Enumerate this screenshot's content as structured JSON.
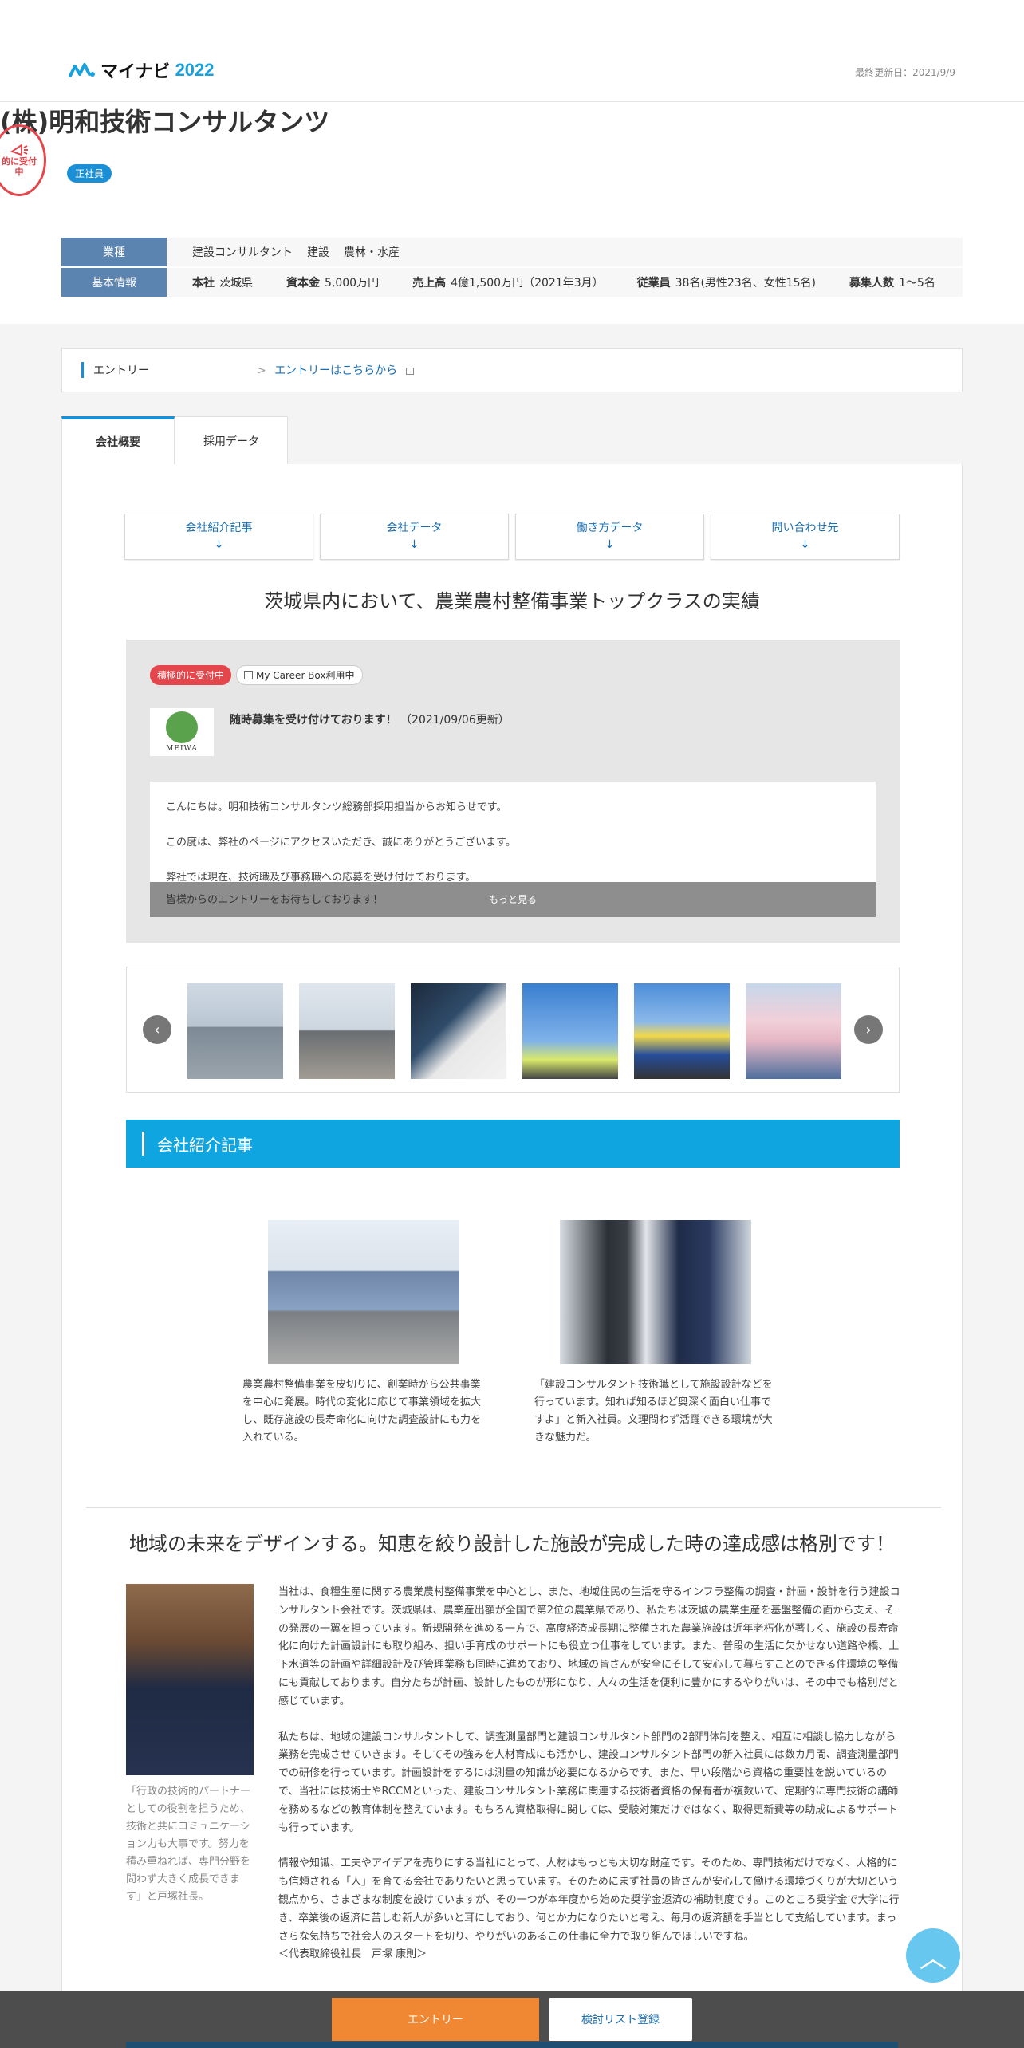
{
  "header": {
    "logo_text": "マイナビ",
    "logo_year": "2022",
    "updated": "最終更新日：2021/9/9"
  },
  "company": {
    "stamp": [
      "的に受付",
      "中"
    ],
    "name": "(株)明和技術コンサルタンツ",
    "badge": "正社員"
  },
  "info": {
    "industry_label": "業種",
    "industry_items": [
      "建設コンサルタント",
      "建設",
      "農林・水産"
    ],
    "basic_label": "基本情報",
    "basic": [
      {
        "k": "本社",
        "v": "茨城県"
      },
      {
        "k": "資本金",
        "v": "5,000万円"
      },
      {
        "k": "売上高",
        "v": "4億1,500万円（2021年3月）"
      },
      {
        "k": "従業員",
        "v": "38名(男性23名、女性15名)"
      },
      {
        "k": "募集人数",
        "v": "1～5名"
      }
    ]
  },
  "entry": {
    "label": "エントリー",
    "link": "エントリーはこちらから"
  },
  "tabs": [
    "会社概要",
    "採用データ"
  ],
  "subnav": [
    "会社紹介記事",
    "会社データ",
    "働き方データ",
    "問い合わせ先"
  ],
  "subnav_arrow": "↓",
  "headline": "茨城県内において、農業農村整備事業トップクラスの実績",
  "news": {
    "tag_active": "積極的に受付中",
    "tag_box": "My Career Box利用中",
    "logo_name": "MEIWA",
    "title": "随時募集を受け付けております！",
    "date": "（2021/09/06更新）",
    "lines": [
      "こんにちは。明和技術コンサルタンツ総務部採用担当からお知らせです。",
      "この度は、弊社のページにアクセスいただき、誠にありがとうございます。",
      "弊社では現在、技術職及び事務職への応募を受け付けております。"
    ],
    "last_line": "皆様からのエントリーをお待ちしております！",
    "more": "もっと見る"
  },
  "carousel": {
    "prev": "‹",
    "next": "›"
  },
  "section_title": "会社紹介記事",
  "features": [
    {
      "text": "農業農村整備事業を皮切りに、創業時から公共事業を中心に発展。時代の変化に応じて事業領域を拡大し、既存施設の長寿命化に向けた調査設計にも力を入れている。"
    },
    {
      "text": "「建設コンサルタント技術職として施設設計などを行っています。知れば知るほど奥深く面白い仕事ですよ」と新入社員。文理問わず活躍できる環境が大きな魅力だ。"
    }
  ],
  "message": {
    "title": "地域の未来をデザインする。知恵を絞り設計した施設が完成した時の達成感は格別です！",
    "caption": "「行政の技術的パートナーとしての役割を担うため、技術と共にコミュニケーション力も大事です。努力を積み重ねれば、専門分野を問わず大きく成長できます」と戸塚社長。",
    "paragraphs": [
      "当社は、食糧生産に関する農業農村整備事業を中心とし、また、地域住民の生活を守るインフラ整備の調査・計画・設計を行う建設コンサルタント会社です。茨城県は、農業産出額が全国で第2位の農業県であり、私たちは茨城の農業生産を基盤整備の面から支え、その発展の一翼を担っています。新規開発を進める一方で、高度経済成長期に整備された農業施設は近年老朽化が著しく、施設の長寿命化に向けた計画設計にも取り組み、担い手育成のサポートにも役立つ仕事をしています。また、普段の生活に欠かせない道路や橋、上下水道等の計画や詳細設計及び管理業務も同時に進めており、地域の皆さんが安全にそして安心して暮らすことのできる住環境の整備にも貢献しております。自分たちが計画、設計したものが形になり、人々の生活を便利に豊かにするやりがいは、その中でも格別だと感じています。",
      "私たちは、地域の建設コンサルタントして、調査測量部門と建設コンサルタント部門の2部門体制を整え、相互に相談し協力しながら業務を完成させていきます。そしてその強みを人材育成にも活かし、建設コンサルタント部門の新入社員には数カ月間、調査測量部門での研修を行っています。計画設計をするには測量の知識が必要になるからです。また、早い段階から資格の重要性を説いているので、当社には技術士やRCCMといった、建設コンサルタント業務に関連する技術者資格の保有者が複数いて、定期的に専門技術の講師を務めるなどの教育体制を整えています。もちろん資格取得に関しては、受験対策だけではなく、取得更新費等の助成によるサポートも行っています。",
      "情報や知識、工夫やアイデアを売りにする当社にとって、人材はもっとも大切な財産です。そのため、専門技術だけでなく、人格的にも信頼される「人」を育てる会社でありたいと思っています。そのためにまず社員の皆さんが安心して働ける環境づくりが大切という観点から、さまざまな制度を設けていますが、その一つが本年度から始めた奨学金返済の補助制度です。このところ奨学金で大学に行き、卒業後の返済に苦しむ新人が多いと耳にしており、何とか力になりたいと考え、毎月の返済額を手当として支給しています。まっさらな気持ちで社会人のスタートを切り、やりがいのあるこの仕事に全力で取り組んでほしいですね。"
    ],
    "signature": "＜代表取締役社長　戸塚 康則＞"
  },
  "float_top": "︿",
  "bottom": {
    "entry": "エントリー",
    "list": "検討リスト登録"
  }
}
